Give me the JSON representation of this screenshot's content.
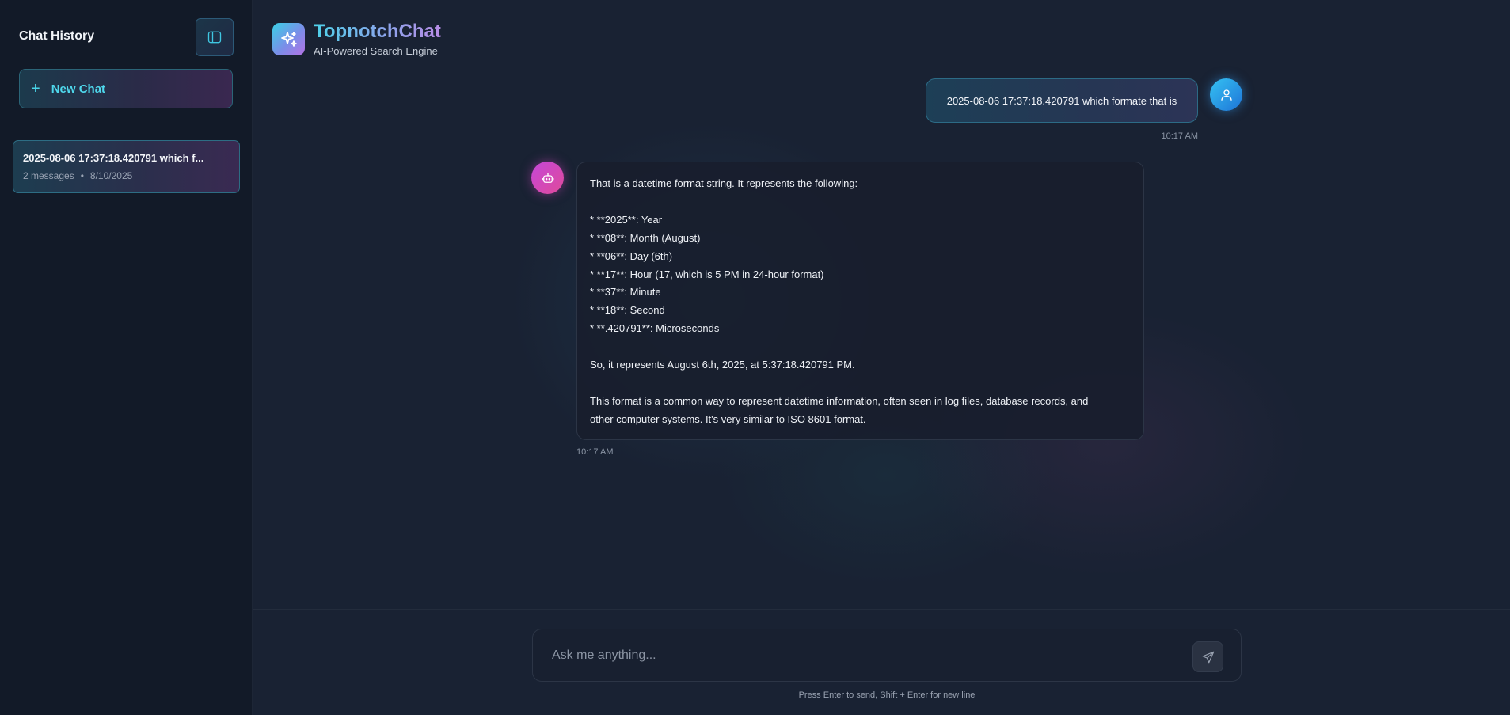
{
  "sidebar": {
    "title": "Chat History",
    "toggle_icon": "sidebar-toggle-icon",
    "new_chat_label": "New Chat",
    "history": [
      {
        "title": "2025-08-06 17:37:18.420791 which f...",
        "count": "2 messages",
        "separator": "•",
        "date": "8/10/2025"
      }
    ]
  },
  "header": {
    "app_name": "TopnotchChat",
    "tagline": "AI-Powered Search Engine"
  },
  "messages": {
    "user": {
      "text": "2025-08-06 17:37:18.420791 which formate that is",
      "time": "10:17 AM"
    },
    "bot": {
      "lines": [
        "That is a datetime format string.  It represents the following:",
        "",
        "*   **2025**: Year",
        "*   **08**: Month (August)",
        "*   **06**: Day (6th)",
        "*   **17**: Hour (17, which is 5 PM in 24-hour format)",
        "*   **37**: Minute",
        "*   **18**: Second",
        "*   **.420791**: Microseconds",
        "",
        "So, it represents August 6th, 2025, at 5:37:18.420791 PM.",
        "",
        "This format is a common way to represent datetime information, often seen in log files, database records, and",
        "other computer systems.  It's very similar to ISO 8601 format."
      ],
      "time": "10:17 AM"
    }
  },
  "composer": {
    "placeholder": "Ask me anything...",
    "value": "",
    "hint": "Press Enter to send, Shift + Enter for new line"
  },
  "colors": {
    "accent_cyan": "#4fd8ec",
    "accent_purple": "#b88ce6",
    "background": "#192233",
    "sidebar": "#121a28"
  }
}
